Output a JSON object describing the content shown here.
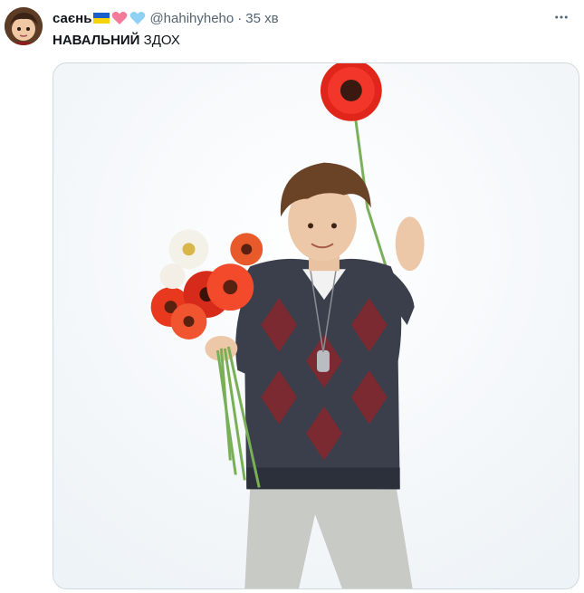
{
  "tweet": {
    "display_name": "саєнь",
    "handle": "@hahihyheho",
    "separator": "·",
    "time": "35 хв",
    "text_bold": "НАВАЛЬНИЙ",
    "text_rest": "ЗДОХ"
  },
  "icons": {
    "avatar": "avatar-image",
    "flag": "ukraine-flag-icon",
    "heart_pink": "pink-heart-icon",
    "heart_blue": "light-blue-heart-icon",
    "more": "more-options-icon"
  },
  "colors": {
    "text": "#0f1419",
    "muted": "#536471",
    "border": "#cfd9de",
    "flag_blue": "#1a5fc9",
    "flag_yellow": "#f6d20b",
    "heart_pink": "#f27c9a",
    "heart_blue": "#8fd0f5"
  }
}
